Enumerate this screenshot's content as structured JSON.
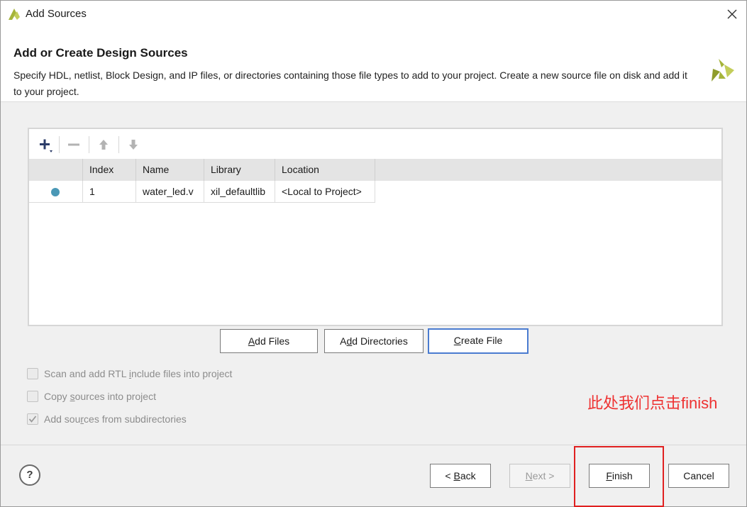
{
  "window": {
    "title": "Add Sources"
  },
  "header": {
    "title": "Add or Create Design Sources",
    "description": "Specify HDL, netlist, Block Design, and IP files, or directories containing those file types to add to your project. Create a new source file on disk and add it to your project."
  },
  "table": {
    "columns": [
      "",
      "Index",
      "Name",
      "Library",
      "Location"
    ],
    "rows": [
      {
        "status": "",
        "index": "1",
        "name": "water_led.v",
        "library": "xil_defaultlib",
        "location": "<Local to Project>"
      }
    ]
  },
  "buttons": {
    "add_files": {
      "mnemonic": "A",
      "rest": "dd Files"
    },
    "add_directories": {
      "prefix": "A",
      "mnemonic": "d",
      "rest": "d Directories"
    },
    "create_file": {
      "mnemonic": "C",
      "rest": "reate File"
    },
    "back": {
      "prefix": "< ",
      "mnemonic": "B",
      "rest": "ack"
    },
    "next": {
      "mnemonic": "N",
      "rest": "ext >"
    },
    "finish": {
      "mnemonic": "F",
      "rest": "inish"
    },
    "cancel": "Cancel",
    "help": "?"
  },
  "options": [
    {
      "prefix": "Scan and add RTL ",
      "mnemonic": "i",
      "rest": "nclude files into project",
      "checked": false
    },
    {
      "prefix": "Copy ",
      "mnemonic": "s",
      "rest": "ources into project",
      "checked": false
    },
    {
      "prefix": "Add sou",
      "mnemonic": "r",
      "rest": "ces from subdirectories",
      "checked": true
    }
  ],
  "annotation": {
    "text": "此处我们点击finish",
    "color": "#ee3232"
  },
  "colors": {
    "status_dot": "#4a98b6",
    "focus_border": "#4a7bd0",
    "logo": "#a5b43a"
  }
}
